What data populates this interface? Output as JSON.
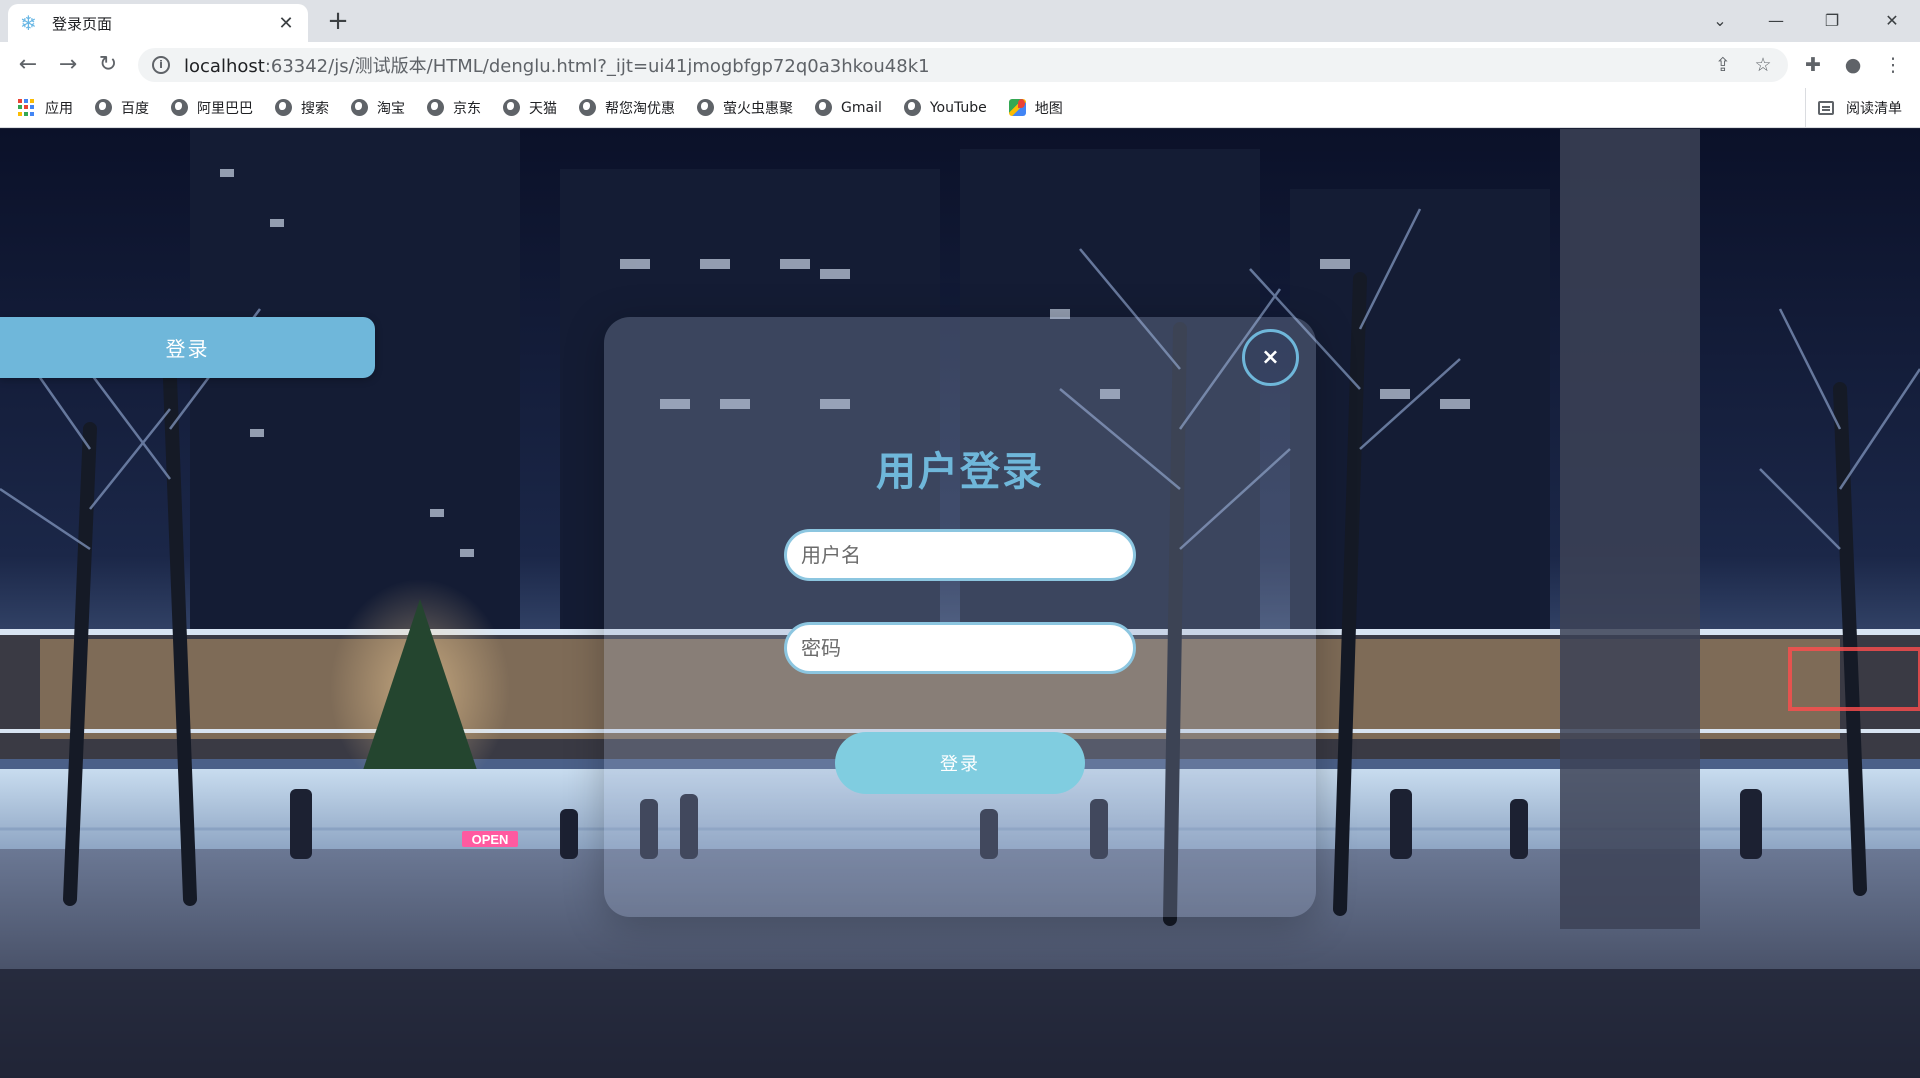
{
  "browser": {
    "tab": {
      "title": "登录页面",
      "favicon": "snowflake-icon"
    },
    "address": {
      "host": "localhost",
      "path": ":63342/js/测试版本/HTML/denglu.html?_ijt=ui41jmogbfgp72q0a3hkou48k1"
    },
    "bookmarks": [
      {
        "label": "应用",
        "icon": "apps-icon"
      },
      {
        "label": "百度",
        "icon": "globe-icon"
      },
      {
        "label": "阿里巴巴",
        "icon": "globe-icon"
      },
      {
        "label": "搜索",
        "icon": "globe-icon"
      },
      {
        "label": "淘宝",
        "icon": "globe-icon"
      },
      {
        "label": "京东",
        "icon": "globe-icon"
      },
      {
        "label": "天猫",
        "icon": "globe-icon"
      },
      {
        "label": "帮您淘优惠",
        "icon": "globe-icon"
      },
      {
        "label": "萤火虫惠聚",
        "icon": "globe-icon"
      },
      {
        "label": "Gmail",
        "icon": "globe-icon"
      },
      {
        "label": "YouTube",
        "icon": "globe-icon"
      },
      {
        "label": "地图",
        "icon": "maps-icon"
      }
    ],
    "reading_list": "阅读清单"
  },
  "page": {
    "side_tab": {
      "label": "登录"
    },
    "dialog": {
      "close": "×",
      "title": "用户登录",
      "username_placeholder": "用户名",
      "password_placeholder": "密码",
      "submit": "登录"
    },
    "scene": {
      "sign_text": "OPEN"
    }
  },
  "colors": {
    "accent": "#6fb7da",
    "button": "#80cde0",
    "input_border": "#8cc6e0"
  }
}
